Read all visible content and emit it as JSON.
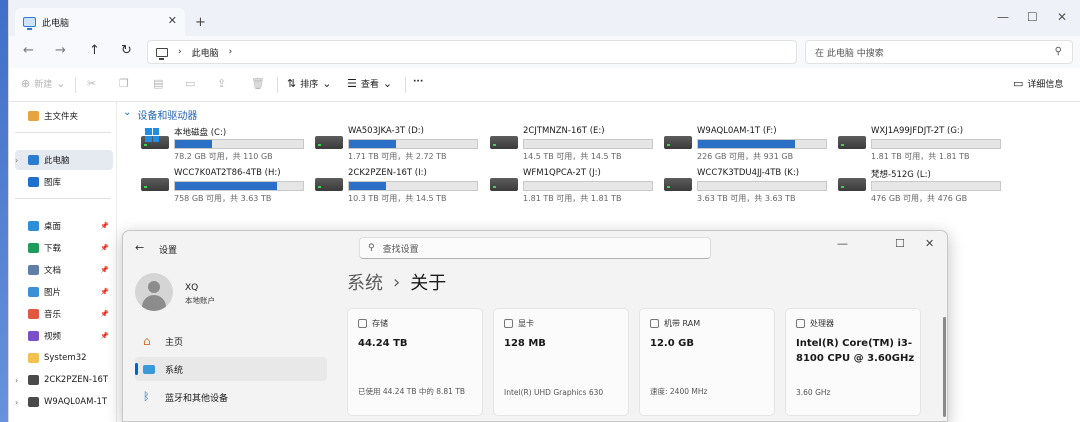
{
  "explorer": {
    "tab_title": "此电脑",
    "tab_close": "✕",
    "tab_add": "+",
    "window_controls": [
      "—",
      "☐",
      "✕"
    ],
    "nav": {
      "back": "←",
      "forward": "→",
      "up": "↑",
      "refresh": "↻"
    },
    "address": {
      "chevron1": "›",
      "location": "此电脑",
      "chevron2": "›"
    },
    "search_placeholder": "在 此电脑 中搜索",
    "toolbar": {
      "new_label": "新建",
      "sort_label": "排序",
      "view_label": "查看",
      "more_label": "···",
      "details_label": "详细信息"
    },
    "sidebar": [
      {
        "label": "主文件夹",
        "icon": "home-icon",
        "color": "#e8a33d",
        "pinned": false
      },
      {
        "label": "此电脑",
        "icon": "pc-icon",
        "color": "#2b7cd3",
        "pinned": false,
        "selected": true
      },
      {
        "label": "图库",
        "icon": "gallery-icon",
        "color": "#1f6fd0",
        "pinned": false
      },
      {
        "label": "桌面",
        "icon": "desktop-icon",
        "color": "#2a8fd8",
        "pinned": true
      },
      {
        "label": "下载",
        "icon": "download-icon",
        "color": "#1d9c5a",
        "pinned": true
      },
      {
        "label": "文档",
        "icon": "documents-icon",
        "color": "#5f7fa8",
        "pinned": true
      },
      {
        "label": "图片",
        "icon": "pictures-icon",
        "color": "#3b8fd8",
        "pinned": true
      },
      {
        "label": "音乐",
        "icon": "music-icon",
        "color": "#e2573e",
        "pinned": true
      },
      {
        "label": "视频",
        "icon": "videos-icon",
        "color": "#7a4fc9",
        "pinned": true
      },
      {
        "label": "System32",
        "icon": "folder-icon",
        "color": "#f2c14e",
        "pinned": false
      },
      {
        "label": "2CK2PZEN-16T",
        "icon": "drive-icon",
        "color": "#4a4a4a",
        "pinned": false
      },
      {
        "label": "W9AQL0AM-1T",
        "icon": "drive-icon",
        "color": "#4a4a4a",
        "pinned": false
      }
    ],
    "section_title": "设备和驱动器",
    "drives": [
      {
        "name": "本地磁盘 (C:)",
        "free": "78.2 GB 可用，共 110 GB",
        "used_fraction": 0.29,
        "system": true
      },
      {
        "name": "WA503JKA-3T (D:)",
        "free": "1.71 TB 可用，共 2.72 TB",
        "used_fraction": 0.37
      },
      {
        "name": "2CJTMNZN-16T (E:)",
        "free": "14.5 TB 可用，共 14.5 TB",
        "used_fraction": 0.0
      },
      {
        "name": "W9AQL0AM-1T (F:)",
        "free": "226 GB 可用，共 931 GB",
        "used_fraction": 0.76
      },
      {
        "name": "WXJ1A99JFDJT-2T (G:)",
        "free": "1.81 TB 可用，共 1.81 TB",
        "used_fraction": 0.0
      },
      {
        "name": "WCC7K0AT2T86-4TB (H:)",
        "free": "758 GB 可用，共 3.63 TB",
        "used_fraction": 0.8
      },
      {
        "name": "2CK2PZEN-16T (I:)",
        "free": "10.3 TB 可用，共 14.5 TB",
        "used_fraction": 0.29
      },
      {
        "name": "WFM1QPCA-2T (J:)",
        "free": "1.81 TB 可用，共 1.81 TB",
        "used_fraction": 0.0
      },
      {
        "name": "WCC7K3TDU4JJ-4TB (K:)",
        "free": "3.63 TB 可用，共 3.63 TB",
        "used_fraction": 0.0
      },
      {
        "name": "梵想-512G (L:)",
        "free": "476 GB 可用，共 476 GB",
        "used_fraction": 0.0
      }
    ]
  },
  "settings": {
    "title": "设置",
    "back": "←",
    "search_placeholder": "查找设置",
    "window_controls": [
      "—",
      "☐",
      "✕"
    ],
    "user": {
      "name": "XQ",
      "account": "本地账户"
    },
    "nav": [
      {
        "label": "主页",
        "icon": "home-icon"
      },
      {
        "label": "系统",
        "icon": "system-icon",
        "selected": true
      },
      {
        "label": "蓝牙和其他设备",
        "icon": "bluetooth-icon"
      }
    ],
    "breadcrumb": {
      "parent": "系统",
      "separator": "›",
      "current": "关于"
    },
    "cards": [
      {
        "label": "存储",
        "value": "44.24 TB",
        "foot": "已使用 44.24 TB 中的 8.81 TB"
      },
      {
        "label": "显卡",
        "value": "128 MB",
        "foot": "Intel(R) UHD Graphics 630"
      },
      {
        "label": "机带 RAM",
        "value": "12.0 GB",
        "foot": "速度: 2400 MHz"
      },
      {
        "label": "处理器",
        "value": "Intel(R) Core(TM) i3-8100 CPU @ 3.60GHz",
        "foot": "3.60 GHz"
      }
    ]
  }
}
